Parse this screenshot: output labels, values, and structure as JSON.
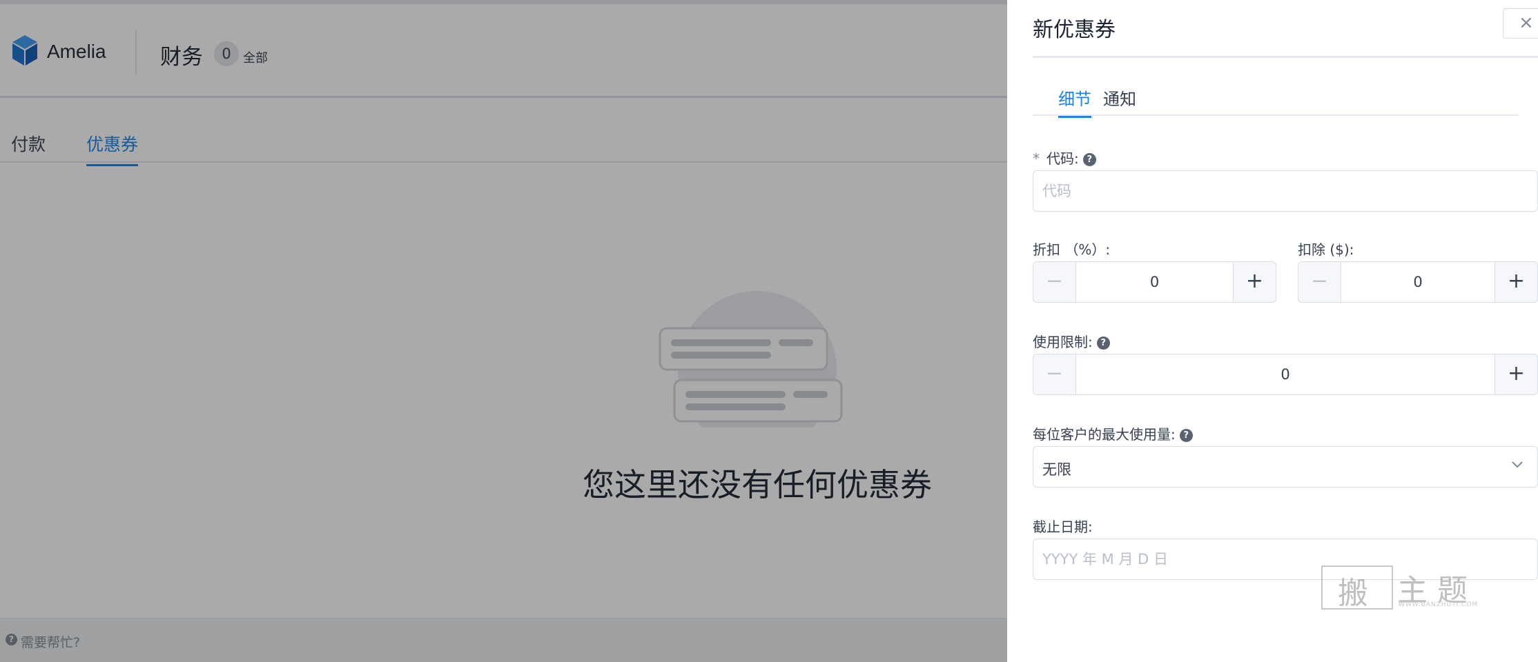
{
  "app": {
    "brand": "Amelia",
    "page_title": "财务",
    "count": "0",
    "count_label": "全部",
    "tabs": [
      {
        "label": "付款",
        "active": false
      },
      {
        "label": "优惠券",
        "active": true
      }
    ],
    "empty_state_text": "您这里还没有任何优惠券",
    "footer_help": "需要帮忙?",
    "brand_color": "#1a84ee"
  },
  "drawer": {
    "title": "新优惠券",
    "close_icon": "close-icon",
    "close_glyph": "×",
    "tabs": [
      {
        "label": "细节",
        "active": true
      },
      {
        "label": "通知",
        "active": false
      }
    ],
    "form": {
      "code": {
        "required_mark": "*",
        "label": "代码:",
        "placeholder": "代码",
        "value": ""
      },
      "discount": {
        "label": "折扣 （%）:",
        "value": "0"
      },
      "deduction": {
        "label": "扣除 ($):",
        "value": "0"
      },
      "usage_limit": {
        "label": "使用限制:",
        "value": "0"
      },
      "max_per_customer": {
        "label": "每位客户的最大使用量:",
        "selected": "无限"
      },
      "expiration": {
        "label": "截止日期:",
        "placeholder": "YYYY 年 M 月 D 日",
        "value": ""
      }
    },
    "stepper_minus": "−",
    "stepper_plus": "+"
  },
  "watermark": {
    "chars": [
      "搬",
      "主",
      "题"
    ],
    "url": "WWW.BANZHUTI.COM"
  }
}
